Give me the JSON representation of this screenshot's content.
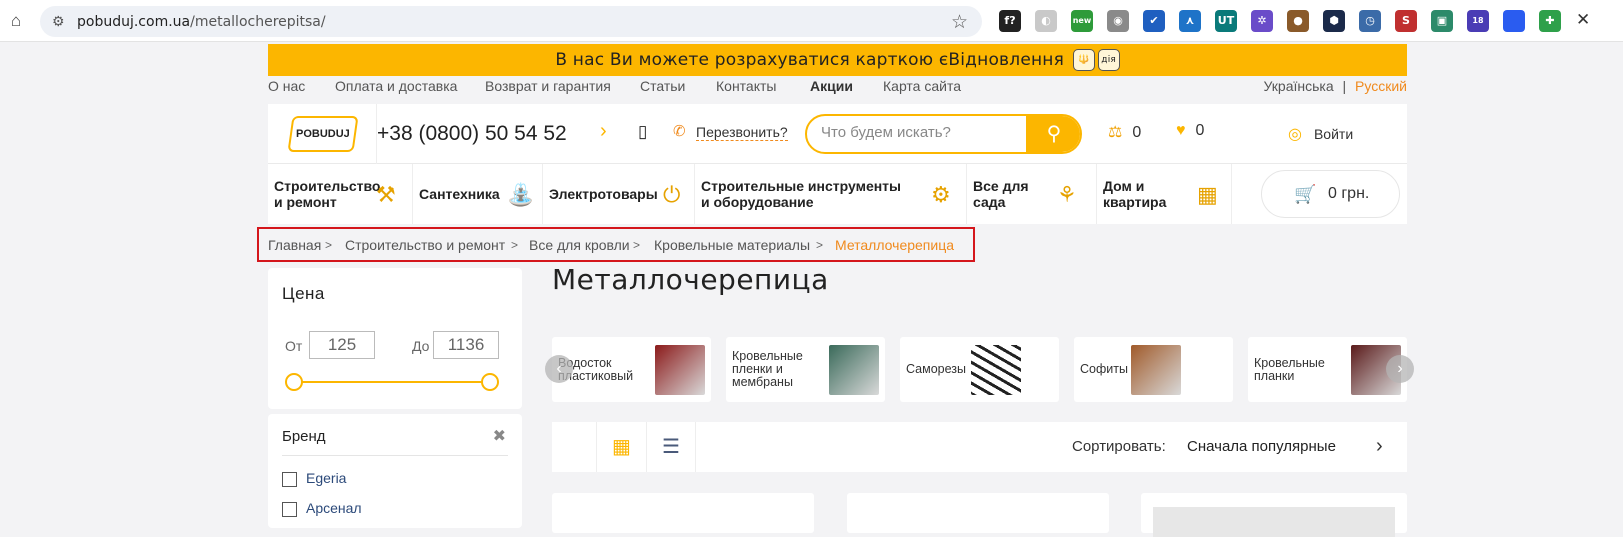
{
  "browser": {
    "url_host": "pobuduj.com.ua",
    "url_path": "/metallocherepitsa/",
    "extensions": [
      {
        "name": "fonts-extension-icon",
        "glyph": "f?",
        "color": "#222222"
      },
      {
        "name": "moon-extension-icon",
        "glyph": "◐",
        "color": "#c9c9c9"
      },
      {
        "name": "new-extension-icon",
        "glyph": "new",
        "color": "#2e9b3a"
      },
      {
        "name": "camera-extension-icon",
        "glyph": "◉",
        "color": "#8a8a8a"
      },
      {
        "name": "checkbox-extension-icon",
        "glyph": "✔",
        "color": "#1f5fc0"
      },
      {
        "name": "pen-extension-icon",
        "glyph": "⋏",
        "color": "#1e73c8"
      },
      {
        "name": "ut-extension-icon",
        "glyph": "UT",
        "color": "#0a7a7a"
      },
      {
        "name": "gear-extension-icon",
        "glyph": "✲",
        "color": "#6a4cc9"
      },
      {
        "name": "cookie-extension-icon",
        "glyph": "●",
        "color": "#8a5a2a"
      },
      {
        "name": "cube-extension-icon",
        "glyph": "⬢",
        "color": "#1b2a4a"
      },
      {
        "name": "clock-extension-icon",
        "glyph": "◷",
        "color": "#3b6ba8"
      },
      {
        "name": "s-extension-icon",
        "glyph": "S",
        "color": "#c03030"
      },
      {
        "name": "image-extension-icon",
        "glyph": "▣",
        "color": "#2c8a6a"
      },
      {
        "name": "grad-extension-icon",
        "glyph": "18",
        "color": "#4a3cb5"
      },
      {
        "name": "circle-extension-icon",
        "glyph": "",
        "color": "#2a5cf0"
      },
      {
        "name": "puzzle-extension-icon",
        "glyph": "✚",
        "color": "#2ea04a"
      }
    ]
  },
  "banner": {
    "text": "В нас Ви можете розрахуватися карткою єВідновлення",
    "badge_1": "🔱",
    "badge_2": "дія"
  },
  "topnav": {
    "items": [
      "О нас",
      "Оплата и доставка",
      "Возврат и гарантия",
      "Статьи",
      "Контакты",
      "Акции",
      "Карта сайта"
    ],
    "lang_ua": "Українська",
    "lang_sep": "|",
    "lang_ru": "Русский"
  },
  "header": {
    "logo": "POBUDUJ",
    "phone": "+38 (0800) 50 54 52",
    "callback": "Перезвонить?",
    "search_placeholder": "Что будем искать?",
    "compare_count": "0",
    "favorites_count": "0",
    "login": "Войти"
  },
  "categories": [
    {
      "label": "Строительство и ремонт",
      "icon": "hammer-icon",
      "glyph": "⚒"
    },
    {
      "label": "Сантехника",
      "icon": "faucet-icon",
      "glyph": "⛲"
    },
    {
      "label": "Электротовары",
      "icon": "plug-icon",
      "glyph": "⏻"
    },
    {
      "label": "Строительные инструменты и оборудование",
      "icon": "drill-icon",
      "glyph": "⚙"
    },
    {
      "label": "Все для сада",
      "icon": "garden-tools-icon",
      "glyph": "⚘"
    },
    {
      "label": "Дом и квартира",
      "icon": "wallpaper-icon",
      "glyph": "▦"
    }
  ],
  "cart": {
    "total": "0 грн."
  },
  "breadcrumb": {
    "items": [
      "Главная",
      "Строительство и ремонт",
      "Все для кровли",
      "Кровельные материалы"
    ],
    "separator": ">",
    "current": "Металлочерепица"
  },
  "page_title": "Металлочерепица",
  "filter_price": {
    "title": "Цена",
    "from_label": "От",
    "from_value": "125",
    "to_label": "До",
    "to_value": "1136",
    "range_min_fraction": 0,
    "range_max_fraction": 1
  },
  "filter_brand": {
    "title": "Бренд",
    "close": "✖",
    "options": [
      "Egeria",
      "Арсенал"
    ]
  },
  "subcategories": [
    {
      "label": "Водосток пластиковый",
      "color": "#8b1a1a"
    },
    {
      "label": "Кровельные пленки и мембраны",
      "color": "#3a6a5a"
    },
    {
      "label": "Саморезы",
      "color": "#222222"
    },
    {
      "label": "Софиты",
      "color": "#a05a2a"
    },
    {
      "label": "Кровельные планки",
      "color": "#5a1a1a"
    }
  ],
  "toolbar": {
    "sort_label": "Сортировать:",
    "sort_value": "Сначала популярные"
  },
  "colors": {
    "accent": "#fcb600",
    "highlight": "#f08a1d",
    "breadcrumb_box": "#d4161c"
  }
}
